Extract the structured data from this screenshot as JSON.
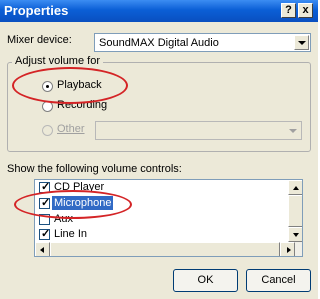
{
  "window": {
    "title": "Properties",
    "help_label": "?",
    "close_label": "x",
    "titlebar_color": "#0b5fd6"
  },
  "mixer": {
    "label": "Mixer device:",
    "value": "SoundMAX Digital Audio"
  },
  "adjust": {
    "legend": "Adjust volume for",
    "options": [
      {
        "label": "Playback",
        "selected": true
      },
      {
        "label": "Recording",
        "selected": false
      },
      {
        "label": "Other",
        "selected": false,
        "disabled": true
      }
    ]
  },
  "controls": {
    "label": "Show the following volume controls:",
    "items": [
      {
        "label": "CD Player",
        "checked": true
      },
      {
        "label": "Microphone",
        "checked": true,
        "highlighted": true
      },
      {
        "label": "Aux",
        "checked": false
      },
      {
        "label": "Line In",
        "checked": true
      }
    ]
  },
  "buttons": {
    "ok": "OK",
    "cancel": "Cancel"
  },
  "annotation_color": "#d42426"
}
